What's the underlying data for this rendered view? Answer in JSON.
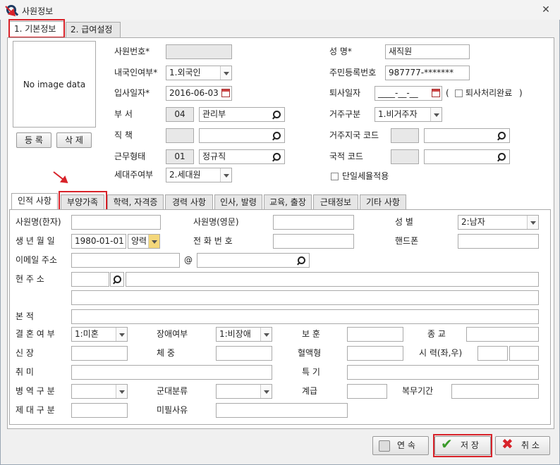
{
  "window": {
    "title": "사원정보",
    "close": "✕"
  },
  "tabs": [
    "1. 기본정보",
    "2. 급여설정"
  ],
  "photo": {
    "text": "No image data",
    "register": "등 록",
    "delete": "삭 제"
  },
  "basic": {
    "emp_no": {
      "label": "사원번호*",
      "value": ""
    },
    "name": {
      "label": "성    명*",
      "value": "새직원"
    },
    "nationality": {
      "label": "내국인여부*",
      "value": "1.외국인"
    },
    "resident_no": {
      "label": "주민등록번호",
      "value": "987777-*******"
    },
    "join_date": {
      "label": "입사일자*",
      "value": "2016-06-03"
    },
    "leave_date": {
      "label": "퇴사일자",
      "value": "____-__-__"
    },
    "leave_done": {
      "paren_open": "(",
      "label": "퇴사처리완료",
      "paren_close": ")"
    },
    "dept": {
      "label": "부    서",
      "code": "04",
      "value": "관리부"
    },
    "residence_type": {
      "label": "거주구분",
      "value": "1.비거주자"
    },
    "position": {
      "label": "직    책",
      "code": "",
      "value": ""
    },
    "residence_code": {
      "label": "거주지국 코드",
      "code": "",
      "value": ""
    },
    "work_type": {
      "label": "근무형태",
      "code": "01",
      "value": "정규직"
    },
    "nation_code": {
      "label": "국적 코드",
      "code": "",
      "value": ""
    },
    "household": {
      "label": "세대주여부",
      "value": "2.세대원"
    },
    "flat_tax": {
      "label": "단일세율적용"
    }
  },
  "subtabs": [
    "인적 사항",
    "부양가족",
    "학력, 자격증",
    "경력 사항",
    "인사, 발령",
    "교육, 출장",
    "근태정보",
    "기타 사항"
  ],
  "personal": {
    "name_hanja": {
      "label": "사원명(한자)",
      "value": ""
    },
    "name_eng": {
      "label": "사원명(영문)",
      "value": ""
    },
    "gender": {
      "label": "성    별",
      "value": "2:남자"
    },
    "birth": {
      "label": "생 년 월 일",
      "value": "1980-01-01",
      "calendar": "양력"
    },
    "phone": {
      "label": "전 화 번 호",
      "value": ""
    },
    "mobile": {
      "label": "핸드폰",
      "value": ""
    },
    "email": {
      "label": "이메일 주소",
      "at": "@",
      "value": "",
      "domain": ""
    },
    "address": {
      "label": "현   주   소",
      "zip": "",
      "line1": "",
      "line2": ""
    },
    "origin": {
      "label": "본          적",
      "value": ""
    },
    "marital": {
      "label": "결 혼  여 부",
      "value": "1:미혼"
    },
    "disability": {
      "label": "장애여부",
      "value": "1:비장애"
    },
    "veteran": {
      "label": "보 훈",
      "value": ""
    },
    "religion": {
      "label": "종 교",
      "value": ""
    },
    "height": {
      "label": "신          장",
      "value": ""
    },
    "weight": {
      "label": "체          중",
      "value": ""
    },
    "blood": {
      "label": "혈액형",
      "value": ""
    },
    "eyesight": {
      "label": "시 력(좌,우)",
      "left": "",
      "right": ""
    },
    "hobby": {
      "label": "취          미",
      "value": ""
    },
    "skill": {
      "label": "특 기",
      "value": ""
    },
    "military": {
      "label": "병 역  구 분",
      "value": ""
    },
    "army_class": {
      "label": "군대분류",
      "value": ""
    },
    "rank": {
      "label": "계급",
      "value": ""
    },
    "service_period": {
      "label": "복무기간",
      "value": ""
    },
    "discharge": {
      "label": "제 대  구 분",
      "value": ""
    },
    "exempt_reason": {
      "label": "미필사유",
      "value": ""
    }
  },
  "buttons": {
    "continue": "연 속",
    "save": "저 장",
    "cancel": "취 소"
  },
  "colors": {
    "highlight": "#d8232a",
    "panel": "#ffffff",
    "bg": "#f0f0f0"
  }
}
